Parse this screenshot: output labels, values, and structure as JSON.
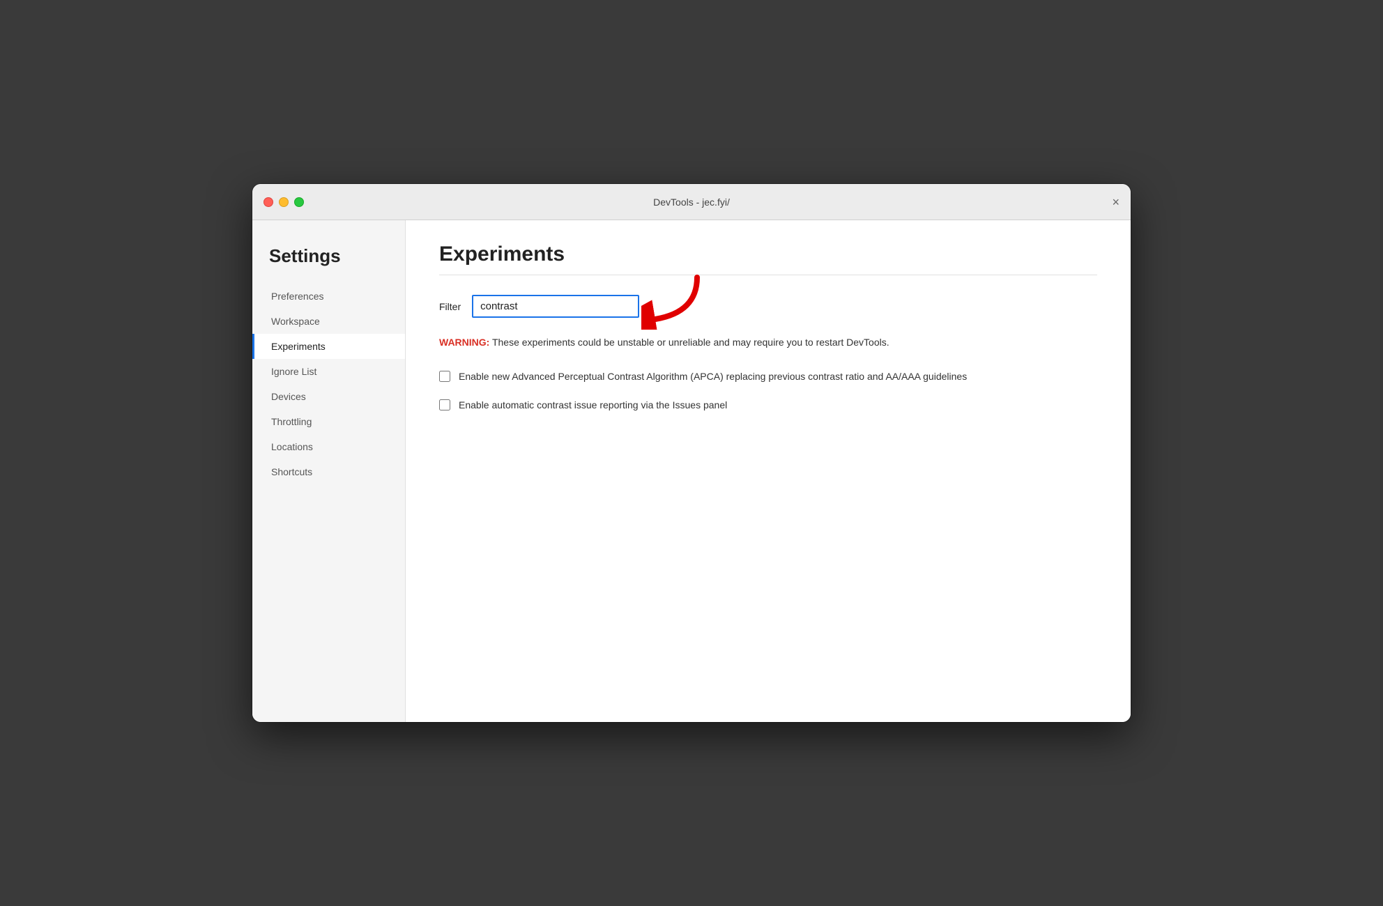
{
  "window": {
    "title": "DevTools - jec.fyi/"
  },
  "sidebar": {
    "heading": "Settings",
    "items": [
      {
        "id": "preferences",
        "label": "Preferences",
        "active": false
      },
      {
        "id": "workspace",
        "label": "Workspace",
        "active": false
      },
      {
        "id": "experiments",
        "label": "Experiments",
        "active": true
      },
      {
        "id": "ignore-list",
        "label": "Ignore List",
        "active": false
      },
      {
        "id": "devices",
        "label": "Devices",
        "active": false
      },
      {
        "id": "throttling",
        "label": "Throttling",
        "active": false
      },
      {
        "id": "locations",
        "label": "Locations",
        "active": false
      },
      {
        "id": "shortcuts",
        "label": "Shortcuts",
        "active": false
      }
    ]
  },
  "main": {
    "title": "Experiments",
    "filter": {
      "label": "Filter",
      "value": "contrast",
      "placeholder": ""
    },
    "warning": {
      "label": "WARNING:",
      "text": " These experiments could be unstable or unreliable and may require you to restart DevTools."
    },
    "checkboxes": [
      {
        "id": "apca",
        "checked": false,
        "label": "Enable new Advanced Perceptual Contrast Algorithm (APCA) replacing previous contrast ratio and AA/AAA guidelines"
      },
      {
        "id": "auto-contrast",
        "checked": false,
        "label": "Enable automatic contrast issue reporting via the Issues panel"
      }
    ]
  },
  "controls": {
    "close_label": "×"
  }
}
